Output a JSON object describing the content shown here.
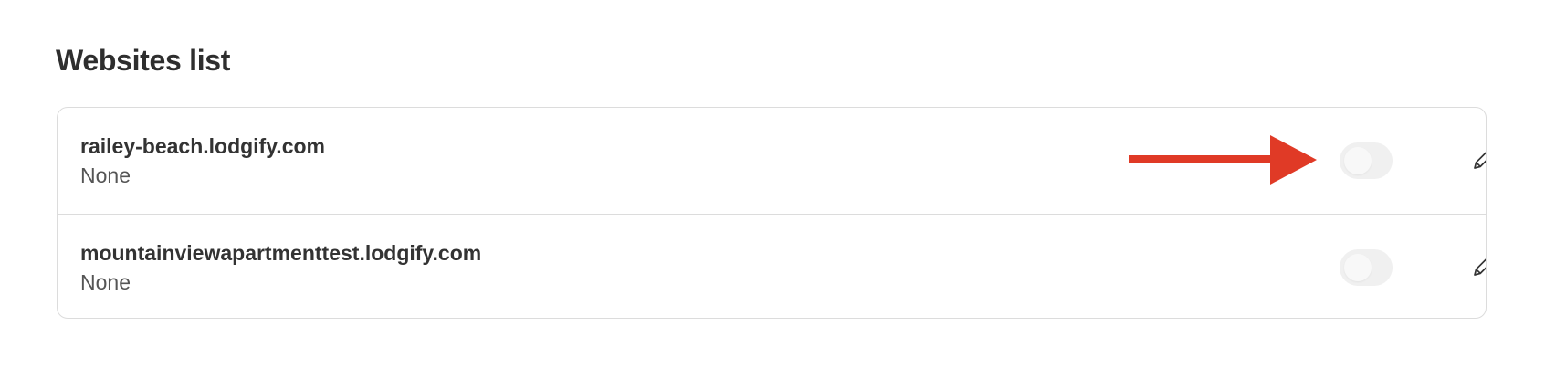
{
  "page": {
    "title": "Websites list"
  },
  "websites": [
    {
      "domain": "railey-beach.lodgify.com",
      "status": "None",
      "enabled": false,
      "icons": {
        "toggle": "toggle-switch",
        "edit": "pencil-icon"
      }
    },
    {
      "domain": "mountainviewapartmenttest.lodgify.com",
      "status": "None",
      "enabled": false,
      "icons": {
        "toggle": "toggle-switch",
        "edit": "pencil-icon"
      }
    }
  ],
  "annotation": {
    "icon": "arrow-right-icon",
    "color": "#e03a26"
  },
  "colors": {
    "card_border": "#dcdcdc",
    "toggle_off": "#f0f0f0",
    "text": "#333333"
  }
}
